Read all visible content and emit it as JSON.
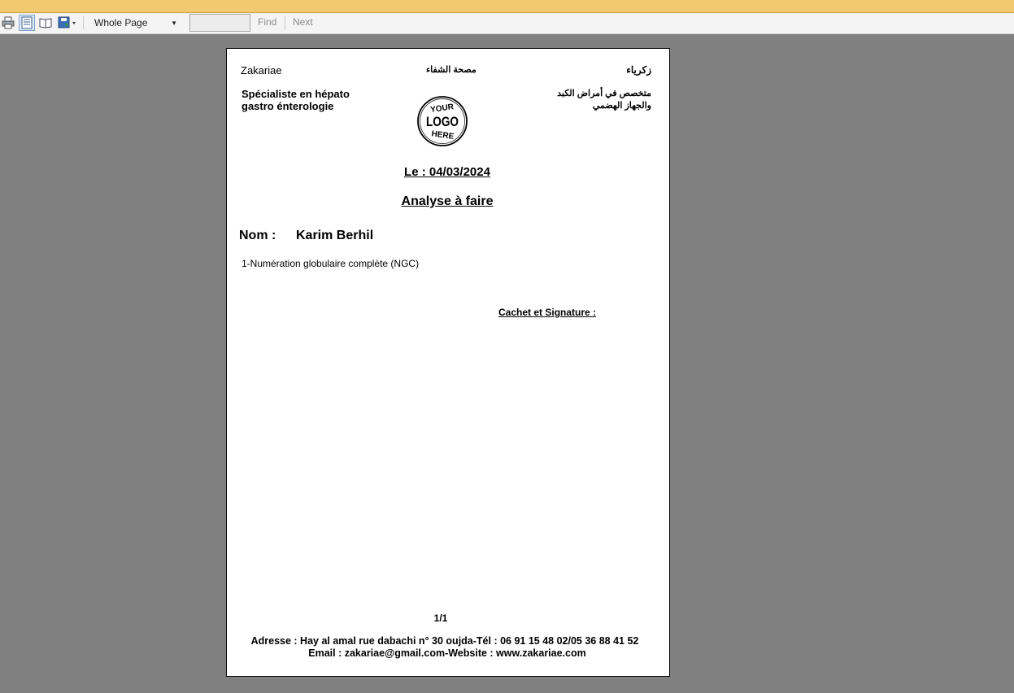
{
  "toolbar": {
    "zoom_value": "Whole Page",
    "find_label": "Find",
    "next_label": "Next",
    "find_placeholder": ""
  },
  "document": {
    "name_fr": "Zakariae",
    "clinic_ar": "مصحة الشفاء",
    "name_ar": "زكرياء",
    "specialty_fr_line1": "Spécialiste en hépato",
    "specialty_fr_line2": "gastro énterologie",
    "specialty_ar_line1": "متخصص في أمراض الكبد",
    "specialty_ar_line2": "والجهاز الهضمي",
    "logo_text": [
      "YOUR",
      "LOGO",
      "HERE"
    ],
    "date_line": "Le : 04/03/2024",
    "title": "Analyse à faire",
    "nom_label": "Nom :",
    "patient_name": "Karim Berhil",
    "analyses": [
      "1-Numération globulaire complète (NGC)"
    ],
    "signature_label": "Cachet  et Signature :",
    "page_number": "1/1",
    "address_line": "Adresse : Hay al amal rue dabachi n° 30 oujda-Tél : 06 91 15 48 02/05 36 88 41 52",
    "contact_line": "Email : zakariae@gmail.com-Website : www.zakariae.com"
  }
}
